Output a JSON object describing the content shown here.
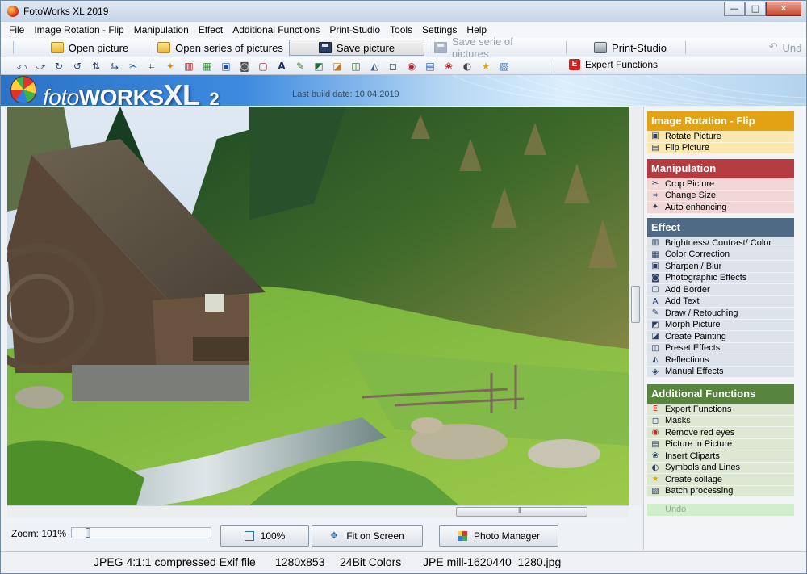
{
  "window": {
    "title": "FotoWorks XL 2019",
    "minimize": "—",
    "maximize": "□",
    "close": "✕"
  },
  "menu": [
    "File",
    "Image Rotation - Flip",
    "Manipulation",
    "Effect",
    "Additional Functions",
    "Print-Studio",
    "Tools",
    "Settings",
    "Help"
  ],
  "toolbar": {
    "open_picture": "Open picture",
    "open_series": "Open series of pictures",
    "save_picture": "Save picture",
    "save_series": "Save serie of pictures",
    "print_studio": "Print-Studio",
    "undo": "Und"
  },
  "tools_row": {
    "expert_icon": "E",
    "expert_label": "Expert Functions",
    "icons": [
      "rotate-left-icon",
      "rotate-right-icon",
      "rotate-cw-icon",
      "rotate-ccw-icon",
      "flip-icon",
      "mirror-icon",
      "cut-icon",
      "crop-icon",
      "magic-icon",
      "brightness-icon",
      "color-icon",
      "sharpen-icon",
      "photo-effects-icon",
      "border-icon",
      "text-icon",
      "draw-icon",
      "morph-icon",
      "painting-icon",
      "preset-icon",
      "reflection-icon",
      "manual-icon",
      "frame-icon",
      "red-eye-icon",
      "picture-in-picture-icon",
      "clipart-icon",
      "collage-icon",
      "batch-icon"
    ]
  },
  "banner": {
    "brand_foto": "foto",
    "brand_works": "WORKS",
    "brand_xl": "XL",
    "brand_two": "2",
    "build": "Last build date: 10.04.2019"
  },
  "zoom": {
    "label": "Zoom: 101%",
    "slider_fraction": 0.1
  },
  "bottom_buttons": {
    "zoom100": "100%",
    "fit": "Fit on Screen",
    "photo_manager": "Photo Manager"
  },
  "status": {
    "format": "JPEG 4:1:1 compressed Exif file",
    "size": "1280x853",
    "colors": "24Bit Colors",
    "file": "JPE mill-1620440_1280.jpg"
  },
  "panel": {
    "groups": [
      {
        "title": "Image Rotation - Flip",
        "color": "#e3a214",
        "bg": "#fbe8b0",
        "items": [
          "Rotate Picture",
          "Flip Picture"
        ],
        "icons": [
          "rotate-picture-icon",
          "flip-picture-icon"
        ]
      },
      {
        "title": "Manipulation",
        "color": "#b43b40",
        "bg": "#f1d6d6",
        "items": [
          "Crop Picture",
          "Change Size",
          "Auto enhancing"
        ],
        "icons": [
          "crop-icon",
          "resize-icon",
          "auto-enhance-icon"
        ]
      },
      {
        "title": "Effect",
        "color": "#4f6a84",
        "bg": "#dde3ea",
        "items": [
          "Brightness/ Contrast/ Color",
          "Color Correction",
          "Sharpen / Blur",
          "Photographic Effects",
          "Add Border",
          "Add Text",
          "Draw / Retouching",
          "Morph Picture",
          "Create Painting",
          "Preset Effects",
          "Reflections",
          "Manual Effects"
        ],
        "icons": [
          "brightness-icon",
          "color-correction-icon",
          "sharpen-icon",
          "photo-effects-icon",
          "border-icon",
          "text-icon",
          "draw-icon",
          "morph-icon",
          "painting-icon",
          "preset-icon",
          "reflection-icon",
          "manual-icon"
        ]
      },
      {
        "title": "Additional Functions",
        "color": "#57853d",
        "bg": "#dde8d3",
        "items": [
          "Expert Functions",
          "Masks",
          "Remove red eyes",
          "Picture in Picture",
          "Insert Cliparts",
          "Symbols and Lines",
          "Create collage",
          "Batch processing"
        ],
        "icons": [
          "expert-icon",
          "masks-icon",
          "red-eye-icon",
          "picture-in-picture-icon",
          "clipart-icon",
          "symbols-icon",
          "collage-icon",
          "batch-icon"
        ]
      }
    ],
    "undo": "Undo"
  }
}
